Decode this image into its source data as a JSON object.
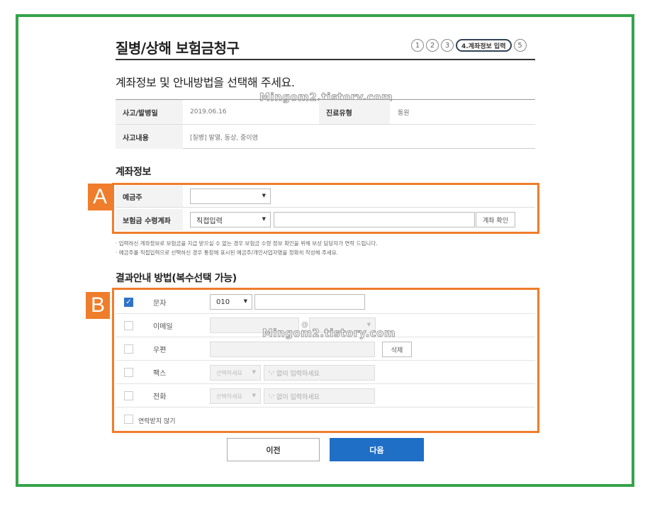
{
  "page": {
    "title": "질병/상해 보험금청구",
    "subtitle": "계좌정보 및 안내방법을 선택해 주세요."
  },
  "steps": [
    "1",
    "2",
    "3",
    "4.계좌정보 입력",
    "5"
  ],
  "watermark": "Mingom2.tistory.com",
  "info": {
    "accident_date_label": "사고/발병일",
    "accident_date_value": "2019.06.16",
    "treatment_type_label": "진료유형",
    "treatment_type_value": "통원",
    "accident_detail_label": "사고내용",
    "accident_detail_value": "[질병] 발열, 동상, 중이염"
  },
  "account": {
    "section_title": "계좌정보",
    "depositor_label": "예금주",
    "depositor_value": "",
    "account_label": "보험금 수령계좌",
    "bank_select_value": "직접입력",
    "account_number_value": "",
    "verify_button": "계좌 확인",
    "notes": [
      "· 입력하신 계좌정보로 보험금을 지급 받으실 수 없는 경우 보험금 수령 정보 확인을 위해 보상 담당자가 연락 드립니다.",
      "· 예금주를 직접입력으로 선택하신 경우 통장에 표시된 예금주/개인사업자명을 정확히 작성해 주세요."
    ]
  },
  "result": {
    "section_title": "결과안내 방법(복수선택 가능)",
    "sms_label": "문자",
    "sms_prefix": "010",
    "email_label": "이메일",
    "email_at": "@",
    "post_label": "우편",
    "post_delete": "삭제",
    "fax_label": "팩스",
    "fax_select": "선택하세요",
    "fax_placeholder": "'-' 없이 입력하세요",
    "phone_label": "전화",
    "phone_select": "선택하세요",
    "phone_placeholder": "'-' 없이 입력하세요",
    "no_contact_label": "연락받지 않기"
  },
  "annotations": {
    "a": "A",
    "b": "B"
  },
  "buttons": {
    "prev": "이전",
    "next": "다음"
  }
}
